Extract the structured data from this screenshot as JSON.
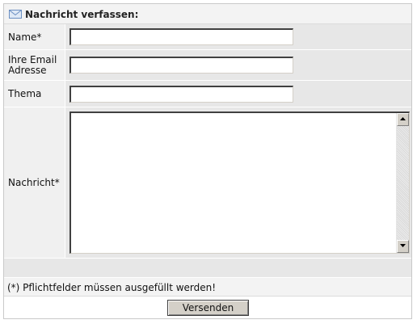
{
  "form": {
    "title": "Nachricht verfassen:",
    "title_icon": "envelope-icon",
    "fields": {
      "name": {
        "label": "Name*",
        "value": "",
        "placeholder": ""
      },
      "email": {
        "label_line1": "Ihre Email",
        "label_line2": "Adresse",
        "value": "",
        "placeholder": ""
      },
      "topic": {
        "label": "Thema",
        "value": "",
        "placeholder": ""
      },
      "message": {
        "label": "Nachricht*",
        "value": "",
        "placeholder": ""
      }
    },
    "required_note": "(*) Pflichtfelder müssen ausgefüllt werden!",
    "submit_label": "Versenden"
  },
  "colors": {
    "label_bg": "#f0f0f0",
    "field_bg": "#e7e7e7",
    "header_bg": "#f3f3f3",
    "button_bg": "#d4d0c8"
  }
}
